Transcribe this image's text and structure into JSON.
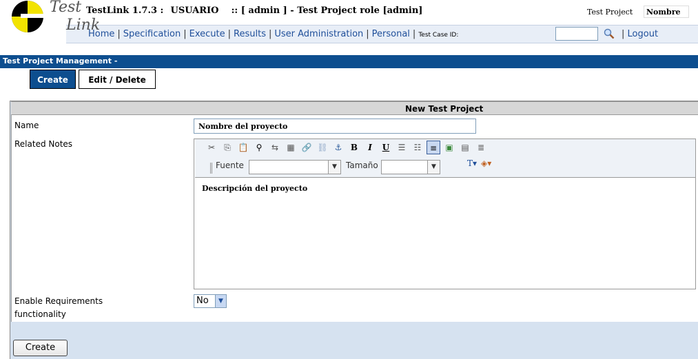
{
  "header": {
    "logo_top": "Test",
    "logo_bottom": "Link",
    "app_name": "TestLink 1.7.3 :",
    "user": "USUARIO",
    "role_text": ":: [ admin ] - Test Project role [admin]",
    "test_project_label": "Test Project",
    "test_project_value": "Nombre"
  },
  "nav": {
    "items": [
      "Home",
      "Specification",
      "Execute",
      "Results",
      "User Administration",
      "Personal"
    ],
    "test_case_label": "Test Case ID:",
    "test_case_value": "",
    "logout": "Logout"
  },
  "section": {
    "title": "Test Project Management -"
  },
  "tabs": [
    {
      "label": "Create",
      "active": true
    },
    {
      "label": "Edit / Delete",
      "active": false
    }
  ],
  "form": {
    "header": "New Test Project",
    "name_label": "Name",
    "name_value": "Nombre del proyecto",
    "notes_label": "Related Notes",
    "notes_value": "Descripción del proyecto",
    "font_label": "Fuente",
    "size_label": "Tamaño",
    "req_label": "Enable Requirements functionality",
    "req_value": "No",
    "submit_label": "Create"
  },
  "toolbar_icons": [
    "cut-icon",
    "copy-icon",
    "paste-icon",
    "find-icon",
    "replace-icon",
    "select-all-icon",
    "link-icon",
    "unlink-icon",
    "anchor-icon",
    "bold-icon",
    "italic-icon",
    "underline-icon",
    "ordered-list-icon",
    "unordered-list-icon",
    "align-left-icon",
    "image-icon",
    "table-icon",
    "horizontal-rule-icon"
  ],
  "colors": {
    "brand_blue": "#0d4e8f",
    "link_blue": "#1f4f9a",
    "panel_bg": "#d6e2f0"
  }
}
